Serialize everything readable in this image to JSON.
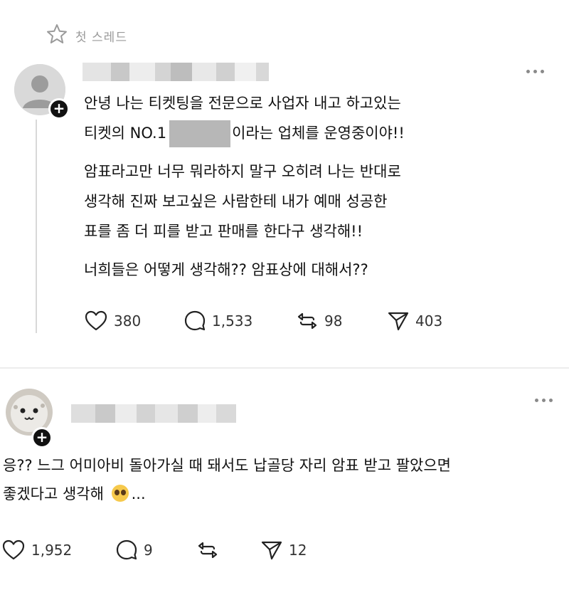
{
  "header": {
    "first_thread_label": "첫 스레드"
  },
  "post": {
    "line1": "안녕 나는 티켓팅을 전문으로 사업자 내고 하고있는",
    "line2_before": "티켓의 NO.1",
    "line2_after": "이라는 업체를 운영중이야!!",
    "p2_l1": "암표라고만 너무 뭐라하지 말구 오히려 나는 반대로",
    "p2_l2": "생각해 진짜 보고싶은 사람한테 내가 예매 성공한",
    "p2_l3": "표를 좀 더 피를 받고 판매를 한다구 생각해!!",
    "p3": "너희들은 어떻게 생각해?? 암표상에 대해서??",
    "likes": "380",
    "comments": "1,533",
    "reposts": "98",
    "shares": "403"
  },
  "reply": {
    "line1": "응?? 느그 어미아비 돌아가실 때 돼서도 납골당 자리 암표 받고 팔았으면",
    "line2": "좋겠다고 생각해",
    "ellipsis": "...",
    "likes": "1,952",
    "comments": "9",
    "shares": "12"
  },
  "icons": {
    "star": "star-icon",
    "more": "more-icon",
    "plus": "plus-icon",
    "heart": "heart-icon",
    "comment": "comment-icon",
    "repost": "repost-icon",
    "send": "send-icon",
    "emoji": "pleading-face-emoji"
  }
}
